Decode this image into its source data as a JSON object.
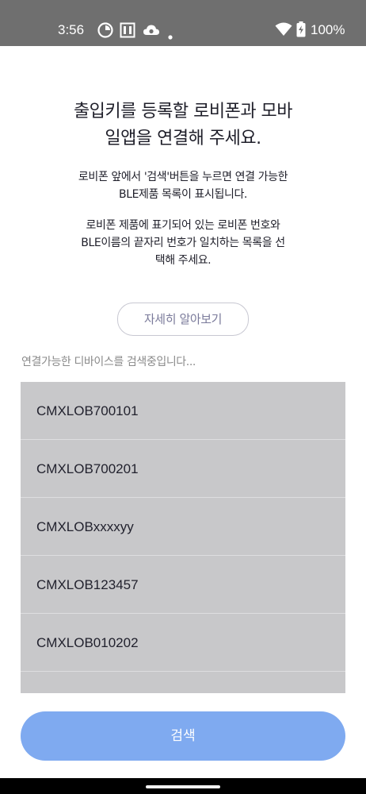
{
  "status_bar": {
    "time": "3:56",
    "battery": "100%",
    "icons": [
      "app-notification-icon",
      "sim-notification-icon",
      "cloud-notification-icon",
      "dot-notification-icon",
      "wifi-icon",
      "battery-charging-icon"
    ]
  },
  "main": {
    "title_line1": "출입키를 등록할 로비폰과 모바",
    "title_line2": "일앱을 연결해 주세요.",
    "desc1_line1": "로비폰 앞에서 '검색'버튼을 누르면 연결 가능한",
    "desc1_line2": "BLE제품 목록이 표시됩니다.",
    "desc2_line1": "로비폰 제품에 표기되어 있는 로비폰 번호와",
    "desc2_line2": "BLE이름의 끝자리 번호가 일치하는 목록을 선",
    "desc2_line3": "택해 주세요.",
    "more_button": "자세히 알아보기",
    "scan_status": "연결가능한 디바이스를 검색중입니다...",
    "devices": [
      "CMXLOB700101",
      "CMXLOB700201",
      "CMXLOBxxxxyy",
      "CMXLOB123457",
      "CMXLOB010202",
      ""
    ],
    "search_button": "검색"
  },
  "colors": {
    "status_bar": "#6f6f6f",
    "list_background": "#c8c8ca",
    "search_button": "#7faaf0",
    "more_button_text": "#7a7a9a"
  }
}
